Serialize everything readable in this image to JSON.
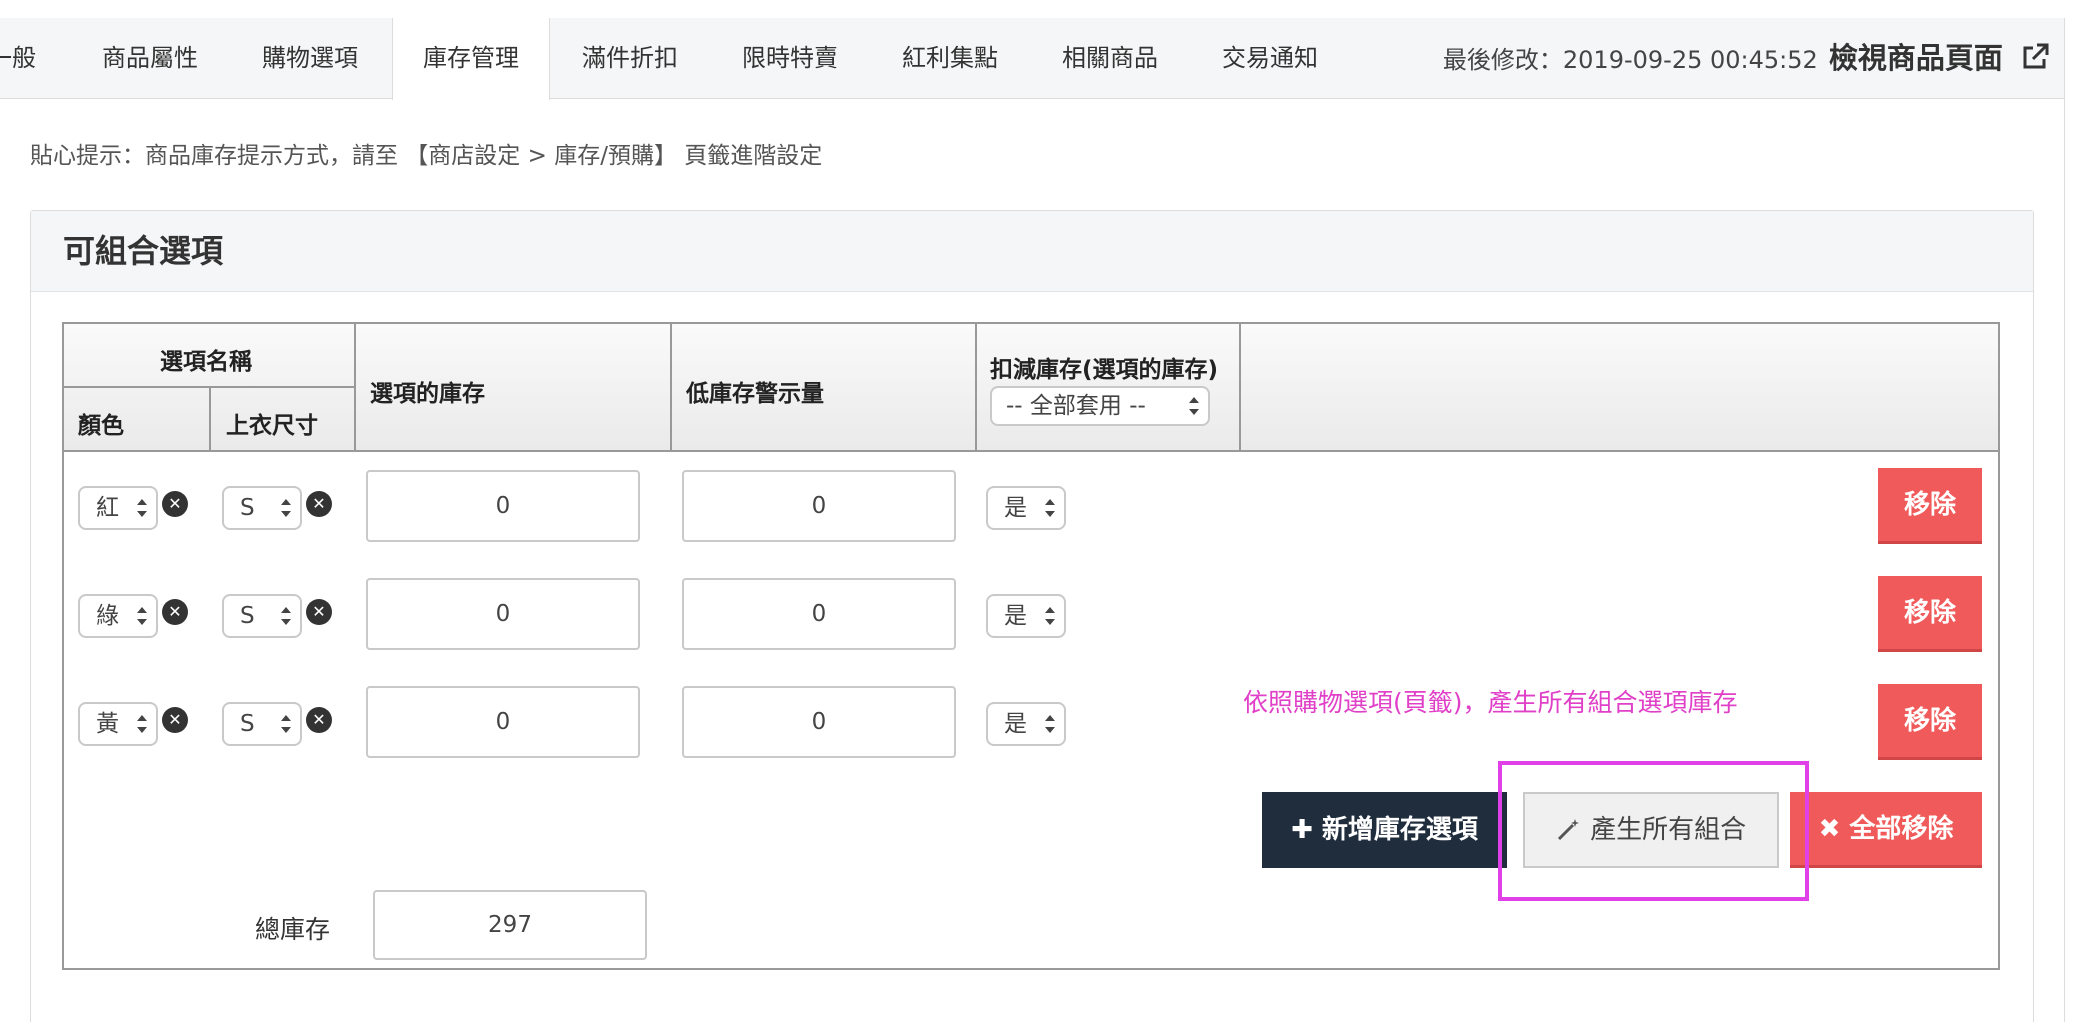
{
  "tabs": [
    {
      "label": "一般"
    },
    {
      "label": "商品屬性"
    },
    {
      "label": "購物選項"
    },
    {
      "label": "庫存管理",
      "active": true
    },
    {
      "label": "滿件折扣"
    },
    {
      "label": "限時特賣"
    },
    {
      "label": "紅利集點"
    },
    {
      "label": "相關商品"
    },
    {
      "label": "交易通知"
    }
  ],
  "header": {
    "last_modified": "最後修改：2019-09-25 00:45:52",
    "view_page": "檢視商品頁面"
  },
  "hint": "貼心提示：商品庫存提示方式，請至 【商店設定 > 庫存/預購】 頁籤進階設定",
  "panel": {
    "title": "可組合選項",
    "columns": {
      "option_name": "選項名稱",
      "color": "顏色",
      "size": "上衣尺寸",
      "stock": "選項的庫存",
      "low_stock_alert": "低庫存警示量",
      "deduct_stock": "扣減庫存(選項的庫存)",
      "apply_all": "-- 全部套用 --"
    },
    "rows": [
      {
        "color": "紅",
        "size": "S",
        "stock": "0",
        "low": "0",
        "deduct": "是",
        "remove": "移除"
      },
      {
        "color": "綠",
        "size": "S",
        "stock": "0",
        "low": "0",
        "deduct": "是",
        "remove": "移除"
      },
      {
        "color": "黃",
        "size": "S",
        "stock": "0",
        "low": "0",
        "deduct": "是",
        "remove": "移除"
      }
    ],
    "annotation": "依照購物選項(頁籤)，產生所有組合選項庫存",
    "buttons": {
      "add": "新增庫存選項",
      "generate": "產生所有組合",
      "remove_all": "全部移除"
    },
    "total_label": "總庫存",
    "total_value": "297"
  }
}
